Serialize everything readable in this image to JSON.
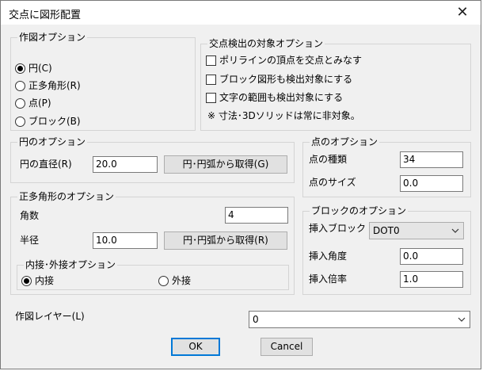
{
  "window": {
    "title": "交点に図形配置",
    "close_glyph": "✕"
  },
  "draw_options": {
    "legend": "作図オプション",
    "radios": [
      {
        "label": "円(C)",
        "checked": true
      },
      {
        "label": "正多角形(R)",
        "checked": false
      },
      {
        "label": "点(P)",
        "checked": false
      },
      {
        "label": "ブロック(B)",
        "checked": false
      }
    ]
  },
  "detect_options": {
    "legend": "交点検出の対象オプション",
    "checks": [
      {
        "label": "ポリラインの頂点を交点とみなす",
        "checked": false
      },
      {
        "label": "ブロック図形も検出対象にする",
        "checked": false
      },
      {
        "label": "文字の範囲も検出対象にする",
        "checked": false
      }
    ],
    "note": "※ 寸法･3Dソリッドは常に非対象。"
  },
  "circle_options": {
    "legend": "円のオプション",
    "diameter_label": "円の直径(R)",
    "diameter_value": "20.0",
    "get_button": "円･円弧から取得(G)"
  },
  "point_options": {
    "legend": "点のオプション",
    "type_label": "点の種類",
    "type_value": "34",
    "size_label": "点のサイズ",
    "size_value": "0.0"
  },
  "polygon_options": {
    "legend": "正多角形のオプション",
    "sides_label": "角数",
    "sides_value": "4",
    "radius_label": "半径",
    "radius_value": "10.0",
    "get_button": "円･円弧から取得(R)",
    "inscribe": {
      "legend": "内接･外接オプション",
      "inner_label": "内接",
      "inner_checked": true,
      "outer_label": "外接",
      "outer_checked": false
    }
  },
  "block_options": {
    "legend": "ブロックのオプション",
    "insert_label": "挿入ブロック",
    "insert_value": "DOT0",
    "angle_label": "挿入角度",
    "angle_value": "0.0",
    "scale_label": "挿入倍率",
    "scale_value": "1.0"
  },
  "layer": {
    "label": "作図レイヤー(L)",
    "value": "0"
  },
  "buttons": {
    "ok": "OK",
    "cancel": "Cancel"
  },
  "icons": {
    "chevron": "chevron-down-icon"
  }
}
